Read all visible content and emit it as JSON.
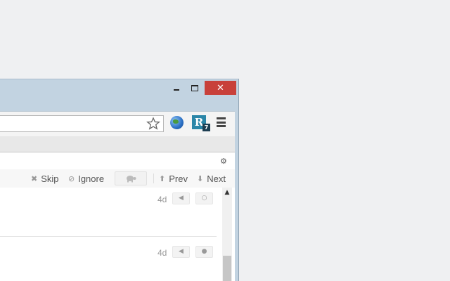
{
  "window": {
    "minimize": "–",
    "close": "✕"
  },
  "toolbar": {
    "omnibox_value": ""
  },
  "actions": {
    "skip": "Skip",
    "ignore": "Ignore",
    "prev": "Prev",
    "next": "Next"
  },
  "items": [
    {
      "age": "4d",
      "toggle_icon": "○"
    },
    {
      "age": "4d",
      "toggle_icon": "●"
    }
  ],
  "colors": {
    "close_button": "#c8403a",
    "frame": "#c2d3e1",
    "ext_icon": "#2b86a8"
  }
}
